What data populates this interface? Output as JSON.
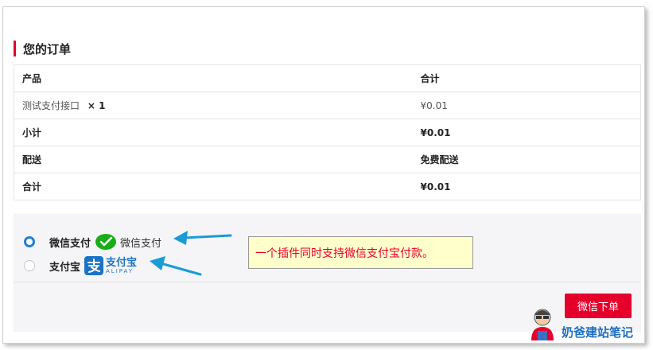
{
  "section_title": "您的订单",
  "order_table": {
    "header": {
      "col1": "产品",
      "col2": "合计"
    },
    "product": {
      "name": "测试支付接口",
      "qty": "× 1",
      "price": "¥0.01"
    },
    "subtotal": {
      "label": "小计",
      "value": "¥0.01"
    },
    "shipping": {
      "label": "配送",
      "value": "免费配送"
    },
    "total": {
      "label": "合计",
      "value": "¥0.01"
    }
  },
  "payment": {
    "wechat": {
      "label": "微信支付",
      "logo_text": "微信支付",
      "icon": "wechat-pay-icon",
      "selected": true
    },
    "alipay": {
      "label": "支付宝",
      "logo_text": "支付宝",
      "logo_sub": "ALIPAY",
      "icon": "alipay-icon",
      "selected": false
    }
  },
  "annotation": "一个插件同时支持微信支付宝付款。",
  "submit_label": "微信下单",
  "watermark": "奶爸建站笔记",
  "colors": {
    "accent": "#e4002b",
    "radio": "#1e7fd8",
    "wechat": "#1aad19",
    "alipay": "#1a74c6",
    "arrow": "#1a9bd7"
  }
}
